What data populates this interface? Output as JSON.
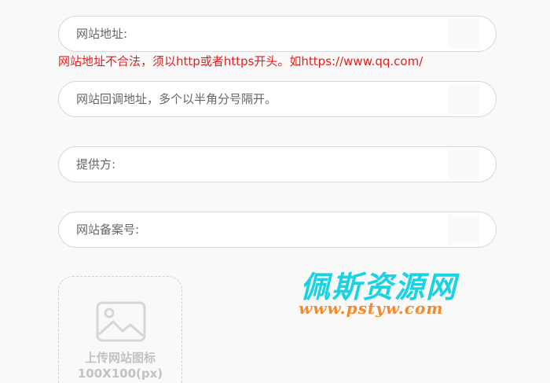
{
  "form": {
    "site_url": {
      "placeholder": "网站地址:",
      "value": "",
      "error": "网站地址不合法，须以http或者https开头。如https://www.qq.com/"
    },
    "callback_url": {
      "placeholder": "网站回调地址，多个以半角分号隔开。",
      "value": ""
    },
    "provider": {
      "placeholder": "提供方:",
      "value": ""
    },
    "record_number": {
      "placeholder": "网站备案号:",
      "value": ""
    },
    "upload": {
      "icon": "image-icon",
      "label": "上传网站图标",
      "size_hint": "100X100(px)"
    }
  },
  "watermark": {
    "title": "佩斯资源网",
    "url": "www.pstyw.com",
    "title_color": "#19d3e3",
    "url_color": "#f38a2b"
  },
  "colors": {
    "error": "#e31e1e",
    "border": "#d9d9d9",
    "placeholder": "#666666",
    "upload_text": "#c2c2c2"
  }
}
